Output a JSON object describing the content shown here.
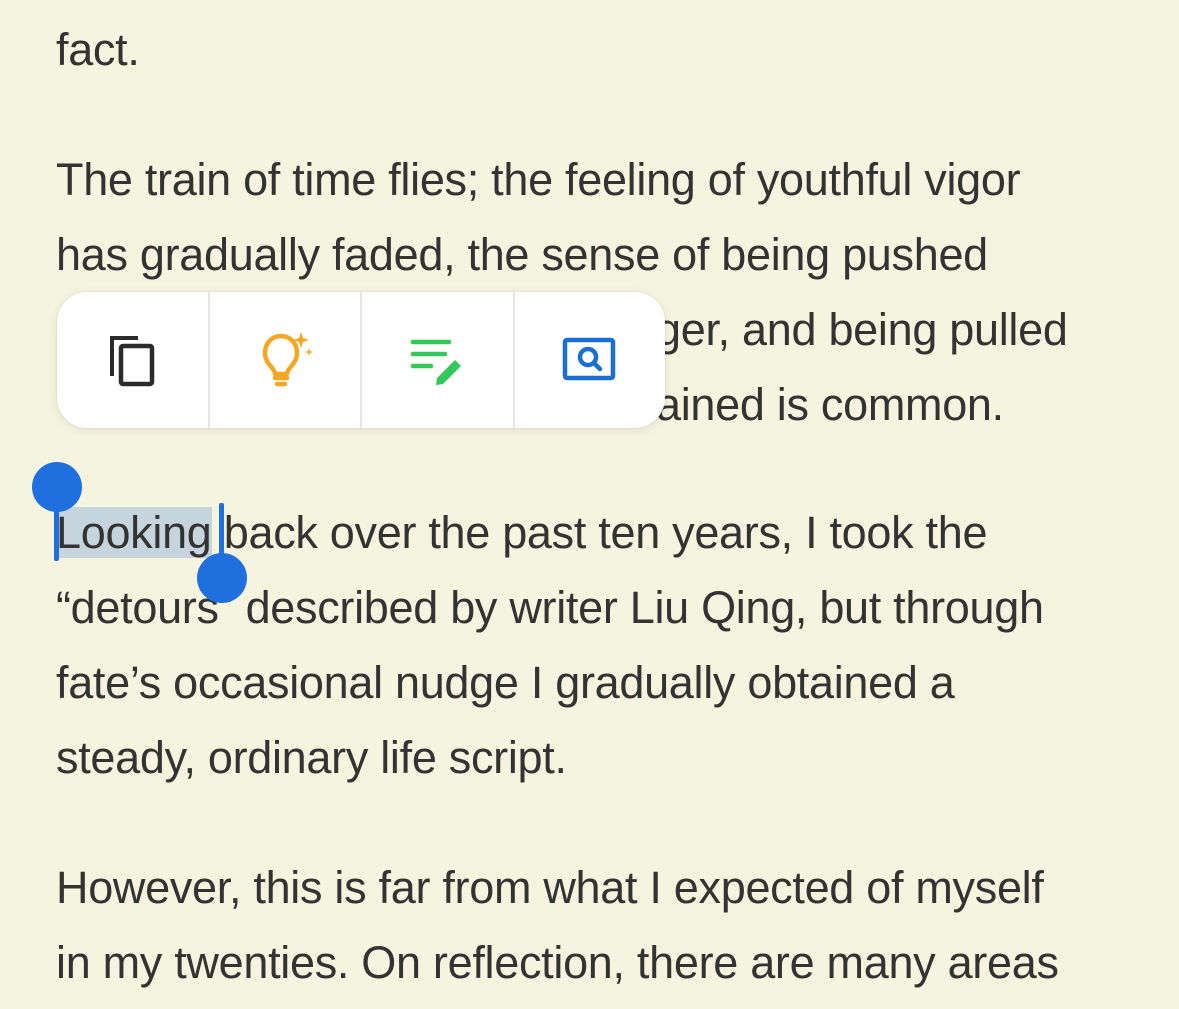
{
  "article": {
    "lines": {
      "l1": "fact.",
      "l2": "The train of time flies; the feeling of youthful vigor",
      "l3": "has gradually faded, the sense of being pushed",
      "l4_visible": "ger, and being pulled",
      "l5_visible": "ained is common.",
      "l6_selected": "Looking",
      "l6_rest": " back over the past ten years, I took the",
      "l7": "“detours” described by writer Liu Qing, but through",
      "l8": "fate’s occasional nudge I gradually obtained a",
      "l9": "steady, ordinary life script.",
      "l10": "However, this is far from what I expected of myself",
      "l11": "in my twenties. On reflection, there are many areas"
    }
  },
  "selection_toolbar": {
    "tools": [
      {
        "icon": "copy-icon"
      },
      {
        "icon": "lightbulb-sparkle-icon"
      },
      {
        "icon": "note-edit-icon"
      },
      {
        "icon": "search-icon"
      }
    ]
  },
  "colors": {
    "background": "#F5F4DE",
    "text": "#333333",
    "selection_handle": "#1F6FDE",
    "copy_icon": "#2B2B2B",
    "idea_icon": "#F5A623",
    "note_icon": "#34C759",
    "search_icon": "#1A6FD1"
  }
}
